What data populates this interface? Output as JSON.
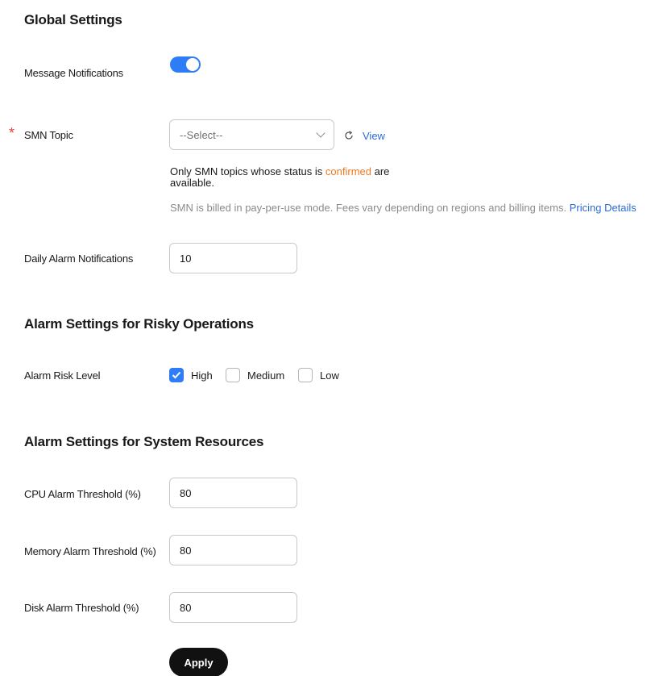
{
  "global": {
    "title": "Global Settings",
    "message_notifications_label": "Message Notifications",
    "message_notifications_on": true,
    "smn_topic_label": "SMN Topic",
    "smn_topic_required_mark": "*",
    "smn_topic_placeholder": "--Select--",
    "view_link": "View",
    "hint_prefix": "Only SMN topics whose status is",
    "hint_confirmed": "confirmed",
    "hint_suffix": "are",
    "hint_line2": "available.",
    "billing_text": "SMN is billed in pay-per-use mode. Fees vary depending on regions and billing items.",
    "pricing_link": "Pricing Details",
    "daily_alarm_label": "Daily Alarm Notifications",
    "daily_alarm_value": "10"
  },
  "risky": {
    "title": "Alarm Settings for Risky Operations",
    "risk_level_label": "Alarm Risk Level",
    "options": [
      {
        "label": "High",
        "checked": true
      },
      {
        "label": "Medium",
        "checked": false
      },
      {
        "label": "Low",
        "checked": false
      }
    ]
  },
  "system": {
    "title": "Alarm Settings for System Resources",
    "cpu_label": "CPU Alarm Threshold (%)",
    "cpu_value": "80",
    "memory_label": "Memory Alarm Threshold (%)",
    "memory_value": "80",
    "disk_label": "Disk Alarm Threshold (%)",
    "disk_value": "80"
  },
  "apply_label": "Apply",
  "colors": {
    "accent": "#2e7cf6",
    "link": "#2e6ad6",
    "confirmed": "#ef7a22",
    "required": "#e0443a"
  }
}
